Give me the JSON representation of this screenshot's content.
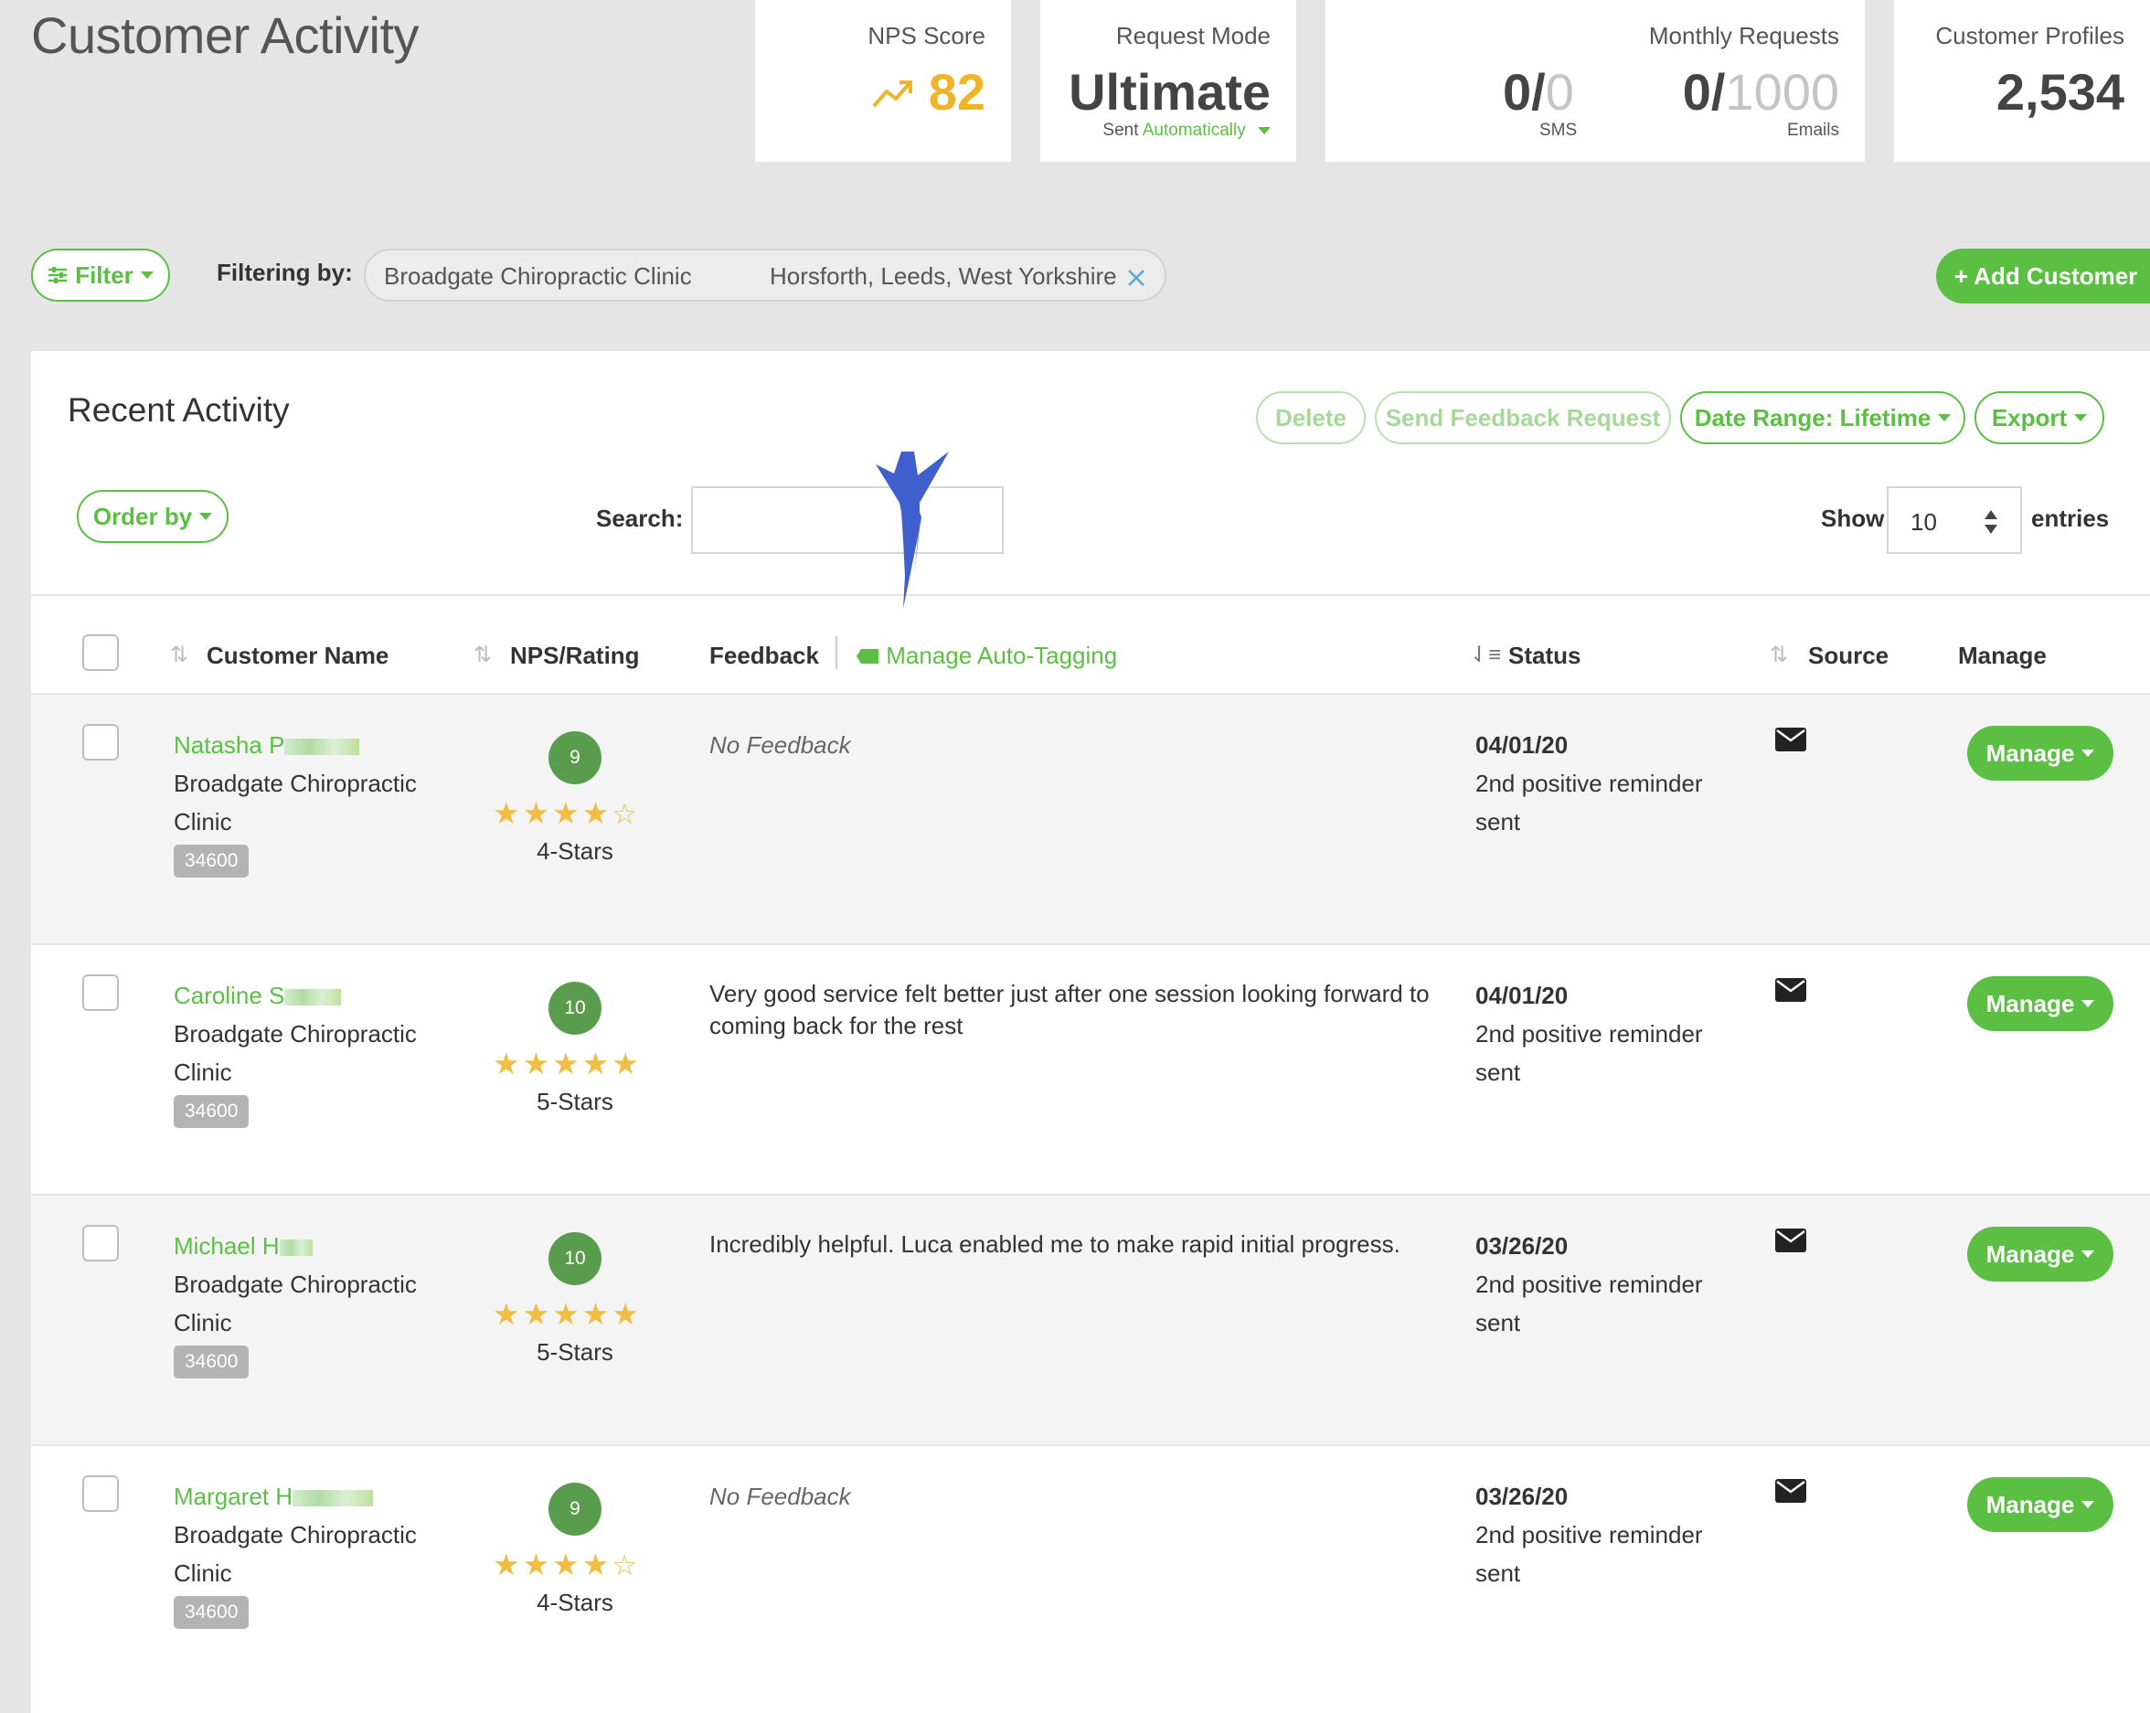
{
  "page": {
    "title": "Customer Activity"
  },
  "stats": {
    "nps": {
      "label": "NPS Score",
      "value": "82"
    },
    "request_mode": {
      "label": "Request Mode",
      "value": "Ultimate",
      "sub_prefix": "Sent",
      "sub_value": "Automatically"
    },
    "monthly": {
      "label": "Monthly Requests",
      "sms_used": "0/",
      "sms_total": "0",
      "sms_label": "SMS",
      "email_used": "0/",
      "email_total": "1000",
      "email_label": "Emails"
    },
    "profiles": {
      "label": "Customer Profiles",
      "value": "2,534"
    }
  },
  "filter": {
    "button_label": "Filter",
    "filtering_by_label": "Filtering by:",
    "clinic": "Broadgate Chiropractic Clinic",
    "location": "Horsforth, Leeds, West Yorkshire"
  },
  "add_customer_label": "+ Add Customer",
  "panel": {
    "title": "Recent Activity",
    "delete_label": "Delete",
    "send_feedback_label": "Send Feedback Request",
    "date_range_label": "Date Range: Lifetime",
    "export_label": "Export",
    "order_by_label": "Order by",
    "search_label": "Search:",
    "search_value": "",
    "show_label": "Show",
    "show_value": "10",
    "entries_label": "entries"
  },
  "columns": {
    "customer_name": "Customer Name",
    "nps_rating": "NPS/Rating",
    "feedback": "Feedback",
    "manage_tagging": "Manage Auto-Tagging",
    "status": "Status",
    "source": "Source",
    "manage": "Manage"
  },
  "rows": [
    {
      "name": "Natasha P",
      "clinic": "Broadgate Chiropractic Clinic",
      "id": "34600",
      "nps": "9",
      "stars_filled": 4,
      "stars_label": "4-Stars",
      "feedback": "No Feedback",
      "status_date": "04/01/20",
      "status_text": "2nd positive reminder sent",
      "manage_label": "Manage"
    },
    {
      "name": "Caroline S",
      "clinic": "Broadgate Chiropractic Clinic",
      "id": "34600",
      "nps": "10",
      "stars_filled": 5,
      "stars_label": "5-Stars",
      "feedback": "Very good service felt better just after one session looking forward to coming back for the rest",
      "status_date": "04/01/20",
      "status_text": "2nd positive reminder sent",
      "manage_label": "Manage"
    },
    {
      "name": "Michael H",
      "clinic": "Broadgate Chiropractic Clinic",
      "id": "34600",
      "nps": "10",
      "stars_filled": 5,
      "stars_label": "5-Stars",
      "feedback": "Incredibly helpful. Luca enabled me to make rapid initial progress.",
      "status_date": "03/26/20",
      "status_text": "2nd positive reminder sent",
      "manage_label": "Manage"
    },
    {
      "name": "Margaret H",
      "clinic": "Broadgate Chiropractic Clinic",
      "id": "34600",
      "nps": "9",
      "stars_filled": 4,
      "stars_label": "4-Stars",
      "feedback": "No Feedback",
      "status_date": "03/26/20",
      "status_text": "2nd positive reminder sent",
      "manage_label": "Manage"
    }
  ],
  "colors": {
    "accent": "#5bbf43",
    "nps_badge": "#5a9c4d",
    "star": "#f0bd45",
    "nps_score": "#f0b429",
    "arrow": "#3f5fcf"
  }
}
